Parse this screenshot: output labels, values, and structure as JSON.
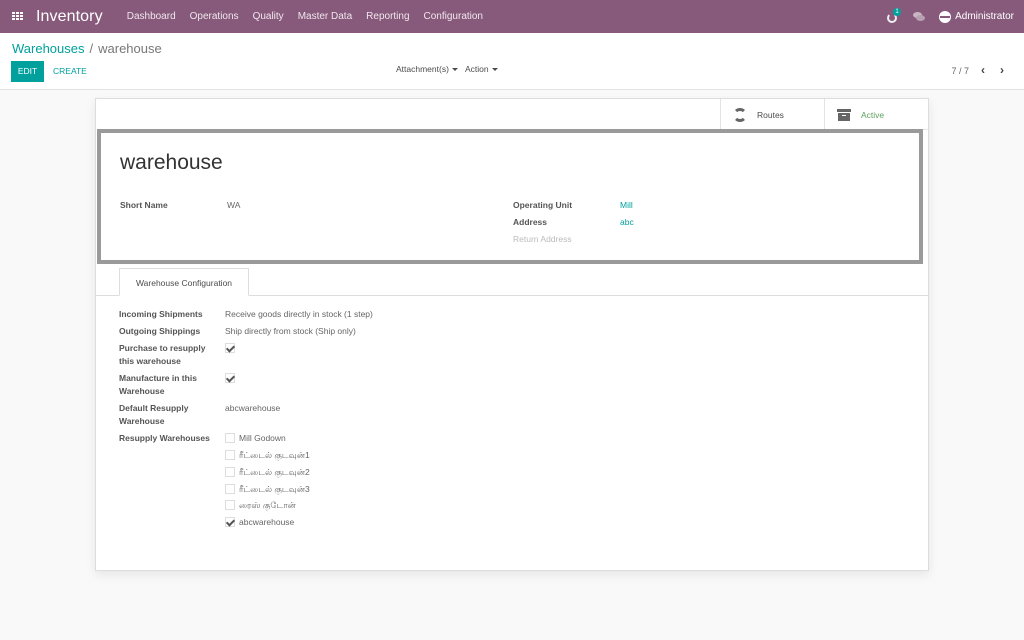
{
  "navbar": {
    "app_name": "Inventory",
    "menu": [
      "Dashboard",
      "Operations",
      "Quality",
      "Master Data",
      "Reporting",
      "Configuration"
    ],
    "activity_badge": "1",
    "user": "Administrator"
  },
  "control_panel": {
    "breadcrumb_parent": "Warehouses",
    "breadcrumb_separator": "/",
    "breadcrumb_current": "warehouse",
    "edit_label": "EDIT",
    "create_label": "CREATE",
    "attachments_label": "Attachment(s)",
    "action_label": "Action",
    "pager": "7 / 7"
  },
  "button_box": {
    "routes_label": "Routes",
    "active_label": "Active",
    "active_color": "#5ea05e"
  },
  "form": {
    "name": "warehouse",
    "short_name_label": "Short Name",
    "short_name": "WA",
    "operating_unit_label": "Operating Unit",
    "operating_unit": "Mill",
    "address_label": "Address",
    "address": "abc",
    "return_address_label": "Return Address"
  },
  "tab": {
    "label": "Warehouse Configuration"
  },
  "config": {
    "incoming_label": "Incoming Shipments",
    "incoming_value": "Receive goods directly in stock (1 step)",
    "outgoing_label": "Outgoing Shippings",
    "outgoing_value": "Ship directly from stock (Ship only)",
    "purchase_label": "Purchase to resupply this warehouse",
    "purchase_checked": true,
    "manufacture_label": "Manufacture in this Warehouse",
    "manufacture_checked": true,
    "default_resupply_label": "Default Resupply Warehouse",
    "default_resupply_value": "abcwarehouse",
    "resupply_label": "Resupply Warehouses",
    "resupply_warehouses": [
      {
        "name": "Mill Godown",
        "checked": false
      },
      {
        "name": "ரீட்டைல் குடவுன்1",
        "checked": false
      },
      {
        "name": "ரீட்டைல் குடவுன்2",
        "checked": false
      },
      {
        "name": "ரீட்டைல் குடவுன்3",
        "checked": false
      },
      {
        "name": "ரைஸ் குடோன்",
        "checked": false
      },
      {
        "name": "abcwarehouse",
        "checked": true
      }
    ]
  }
}
